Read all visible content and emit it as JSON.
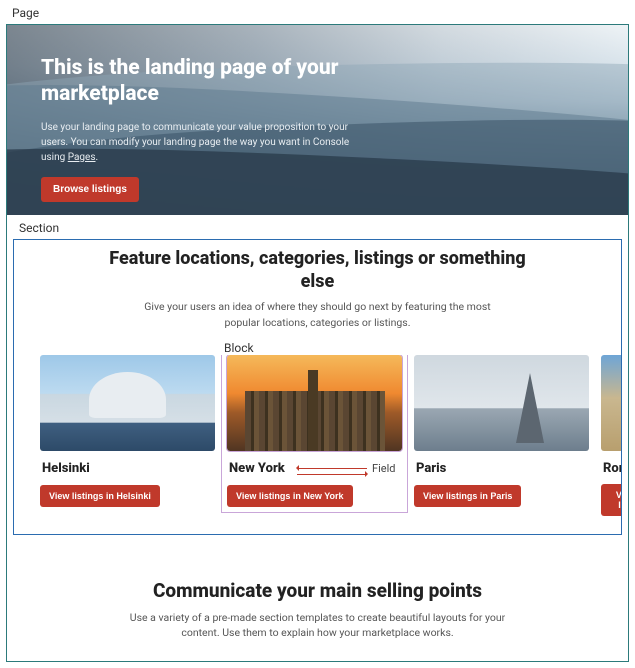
{
  "labels": {
    "page": "Page",
    "section": "Section",
    "block": "Block",
    "field": "Field"
  },
  "hero": {
    "title": "This is the landing page of your marketplace",
    "description_pre": "Use your landing page to communicate your value proposition to your users. You can modify your landing page the way you want in Console using ",
    "description_link": "Pages",
    "description_post": ".",
    "cta": "Browse listings"
  },
  "feature": {
    "heading": "Feature locations, categories, listings or something else",
    "sub": "Give your users an idea of where they should go next by featuring the most popular locations, categories or listings.",
    "cards": [
      {
        "title": "Helsinki",
        "cta": "View listings in Helsinki"
      },
      {
        "title": "New York",
        "cta": "View listings in New York"
      },
      {
        "title": "Paris",
        "cta": "View listings in Paris"
      },
      {
        "title": "Rome",
        "cta": "View listi"
      }
    ]
  },
  "communicate": {
    "heading": "Communicate your main selling points",
    "sub": "Use a variety of a pre-made section templates to create beautiful layouts for your content. Use them to explain how your marketplace works."
  }
}
